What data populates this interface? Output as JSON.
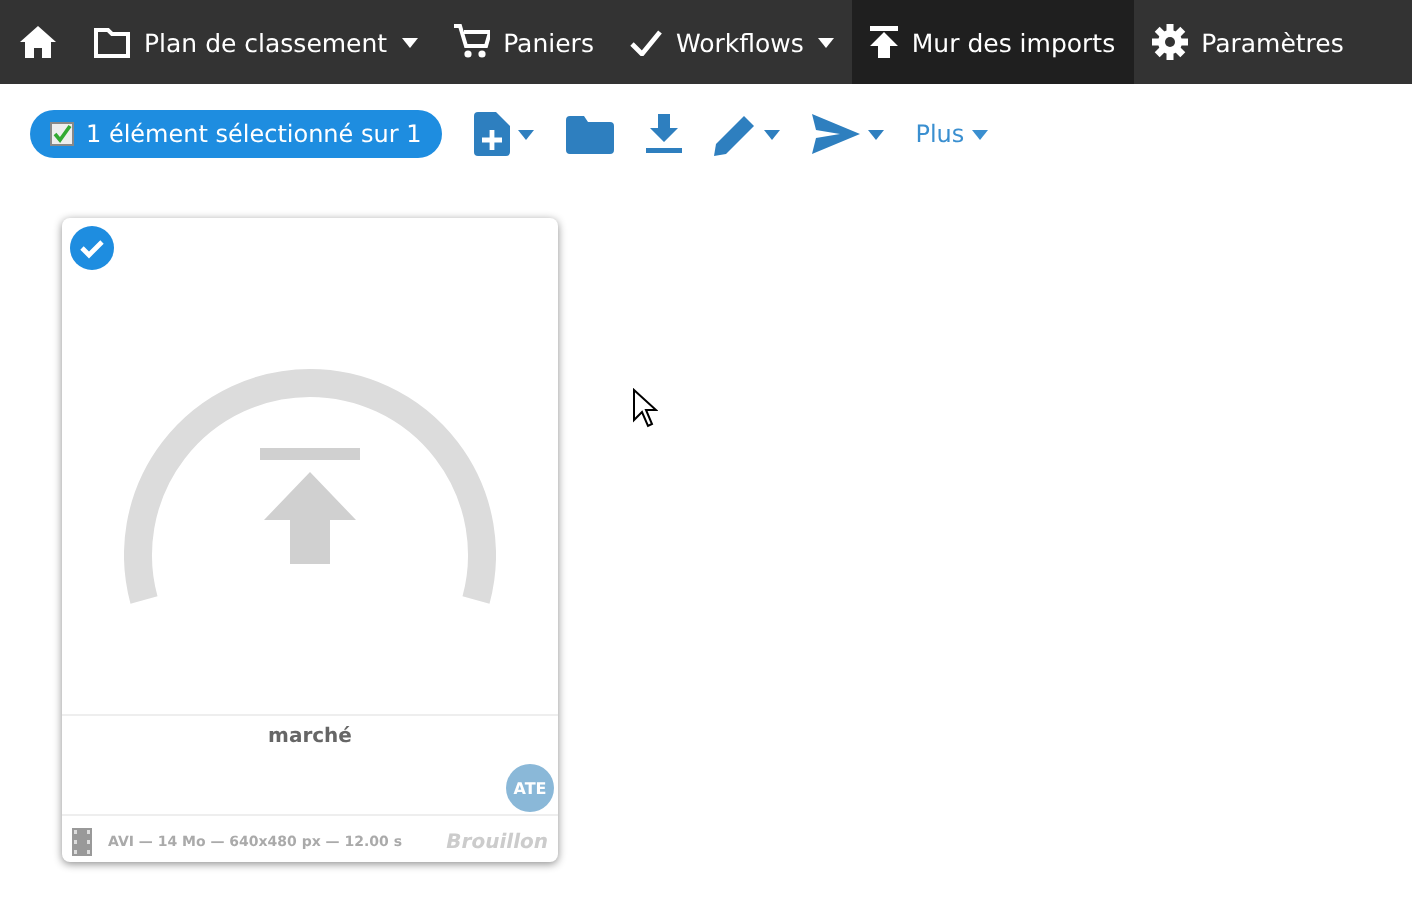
{
  "navbar": {
    "items": [
      {
        "label": "Plan de classement",
        "dropdown": true,
        "selected": false
      },
      {
        "label": "Paniers",
        "dropdown": false,
        "selected": false
      },
      {
        "label": "Workflows",
        "dropdown": true,
        "selected": false
      },
      {
        "label": "Mur des imports",
        "dropdown": false,
        "selected": true
      },
      {
        "label": "Paramètres",
        "dropdown": false,
        "selected": false
      }
    ]
  },
  "toolbar": {
    "selection": "1 élément sélectionné sur 1",
    "actions": [
      {
        "dropdown": true
      },
      {
        "dropdown": false
      },
      {
        "dropdown": false
      },
      {
        "dropdown": true
      },
      {
        "dropdown": true
      }
    ],
    "more": {
      "label": "Plus",
      "dropdown": true
    }
  },
  "cards": [
    {
      "selected": true,
      "title": "marché",
      "avatar": "ATE",
      "meta": "AVI — 14 Mo — 640x480 px — 12.00 s",
      "status": "Brouillon"
    }
  ]
}
